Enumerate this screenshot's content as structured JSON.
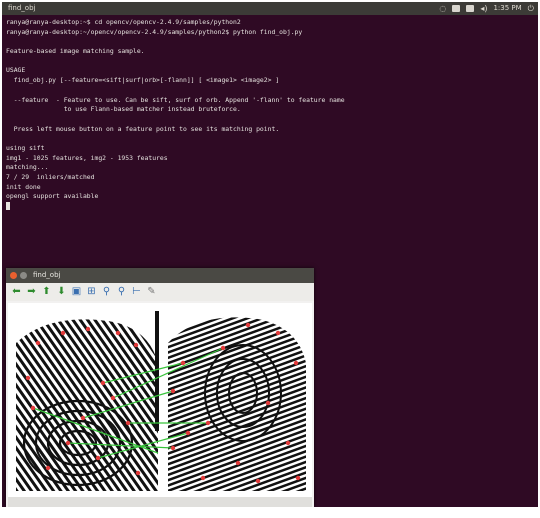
{
  "topbar": {
    "title": "find_obj",
    "clock": "1:35 PM",
    "tray_icons": [
      "wifi-icon",
      "keyboard-icon",
      "battery-icon",
      "volume-icon",
      "power-icon"
    ]
  },
  "terminal": {
    "lines": [
      "ranya@ranya-desktop:~$ cd opencv/opencv-2.4.9/samples/python2",
      "ranya@ranya-desktop:~/opencv/opencv-2.4.9/samples/python2$ python find_obj.py",
      "",
      "Feature-based image matching sample.",
      "",
      "USAGE",
      "  find_obj.py [--feature=<sift|surf|orb>[-flann]] [ <image1> <image2> ]",
      "",
      "  --feature  - Feature to use. Can be sift, surf of orb. Append '-flann' to feature name",
      "               to use Flann-based matcher instead bruteforce.",
      "",
      "  Press left mouse button on a feature point to see its matching point.",
      "",
      "using sift",
      "img1 - 1025 features, img2 - 1953 features",
      "matching...",
      "7 / 29  inliers/matched",
      "init done",
      "opengl support available"
    ]
  },
  "window": {
    "title": "find_obj",
    "toolbar": [
      {
        "name": "arrow-left-icon",
        "glyph": "⬅",
        "tone": "green"
      },
      {
        "name": "arrow-right-icon",
        "glyph": "➡",
        "tone": "green"
      },
      {
        "name": "arrow-up-icon",
        "glyph": "⬆",
        "tone": "green"
      },
      {
        "name": "arrow-down-icon",
        "glyph": "⬇",
        "tone": "green"
      },
      {
        "name": "save-icon",
        "glyph": "▣",
        "tone": "blue"
      },
      {
        "name": "properties-icon",
        "glyph": "⊞",
        "tone": "blue"
      },
      {
        "name": "zoom-in-icon",
        "glyph": "⚲",
        "tone": "blue"
      },
      {
        "name": "zoom-out-icon",
        "glyph": "⚲",
        "tone": "blue"
      },
      {
        "name": "fit-icon",
        "glyph": "⊢",
        "tone": "blue"
      },
      {
        "name": "edit-icon",
        "glyph": "✎",
        "tone": "grey"
      }
    ]
  },
  "colors": {
    "terminal_bg": "#2f0a24",
    "match_line": "#37c43a",
    "keypoint": "#e23a3a"
  }
}
